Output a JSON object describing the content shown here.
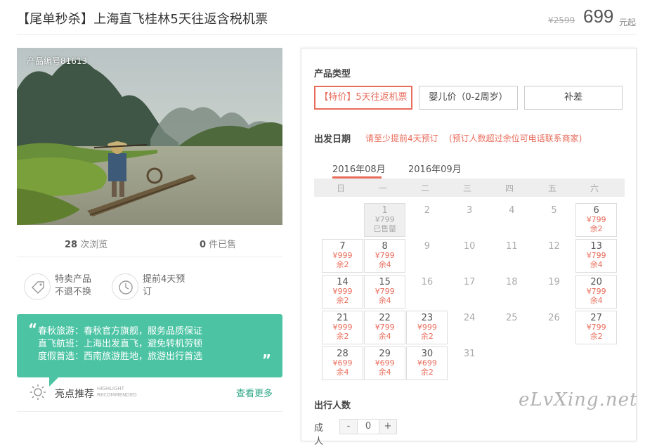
{
  "header": {
    "title": "【尾单秒杀】上海直飞桂林5天往返含税机票",
    "old_price": "¥2599",
    "price": "699",
    "price_unit": "元起"
  },
  "photo": {
    "product_no": "产品编号81613"
  },
  "stats": {
    "views_count": "28",
    "views_label": " 次浏览",
    "sold_count": "0",
    "sold_label": " 件已售"
  },
  "features": [
    {
      "icon": "tag-icon",
      "line1": "特卖产品",
      "line2": "不退不换"
    },
    {
      "icon": "clock-icon",
      "line1": "提前4天预",
      "line2": "订"
    }
  ],
  "highlights": {
    "lines": [
      "春秋旅游：春秋官方旗舰，服务品质保证",
      "直飞航班：上海出发直飞，避免转机劳顿",
      "度假首选：西南旅游胜地，旅游出行首选"
    ],
    "title": "亮点推荐",
    "en_line1": "HIGHLIGHT",
    "en_line2": "RECOMMENDED",
    "more": "查看更多"
  },
  "booking": {
    "product_type_label": "产品类型",
    "types": [
      "【特价】5天往返机票",
      "婴儿价（0-2周岁）",
      "补差"
    ],
    "date_label": "出发日期",
    "date_note1": "请至少提前4天预订",
    "date_note2": "(预订人数超过余位可电话联系商家)",
    "months": [
      "2016年08月",
      "2016年09月"
    ],
    "weekdays": [
      "日",
      "一",
      "二",
      "三",
      "四",
      "五",
      "六"
    ],
    "people_label": "出行人数",
    "adult_label": "成人",
    "adult_value": "0",
    "minus": "-",
    "plus": "+"
  },
  "calendar": [
    {
      "day": "1",
      "price": "¥799",
      "remain": "已售罄",
      "status": "sold"
    },
    {
      "day": "2"
    },
    {
      "day": "3"
    },
    {
      "day": "4"
    },
    {
      "day": "5"
    },
    {
      "day": "6",
      "price": "¥799",
      "remain": "余2"
    },
    {
      "day": "7",
      "price": "¥999",
      "remain": "余2"
    },
    {
      "day": "8",
      "price": "¥799",
      "remain": "余4"
    },
    {
      "day": "9"
    },
    {
      "day": "10"
    },
    {
      "day": "11"
    },
    {
      "day": "12"
    },
    {
      "day": "13",
      "price": "¥799",
      "remain": "余4"
    },
    {
      "day": "14",
      "price": "¥999",
      "remain": "余2"
    },
    {
      "day": "15",
      "price": "¥799",
      "remain": "余4"
    },
    {
      "day": "16"
    },
    {
      "day": "17"
    },
    {
      "day": "18"
    },
    {
      "day": "19"
    },
    {
      "day": "20",
      "price": "¥799",
      "remain": "余4"
    },
    {
      "day": "21",
      "price": "¥999",
      "remain": "余2"
    },
    {
      "day": "22",
      "price": "¥799",
      "remain": "余4"
    },
    {
      "day": "23",
      "price": "¥999",
      "remain": "余2"
    },
    {
      "day": "24"
    },
    {
      "day": "25"
    },
    {
      "day": "26"
    },
    {
      "day": "27",
      "price": "¥799",
      "remain": "余2"
    },
    {
      "day": "28",
      "price": "¥699",
      "remain": "余4"
    },
    {
      "day": "29",
      "price": "¥699",
      "remain": "余4"
    },
    {
      "day": "30",
      "price": "¥699",
      "remain": "余2"
    },
    {
      "day": "31"
    }
  ],
  "watermark": "eLvXing.net",
  "colors": {
    "accent": "#e86c5b",
    "green": "#4cc4a4"
  }
}
